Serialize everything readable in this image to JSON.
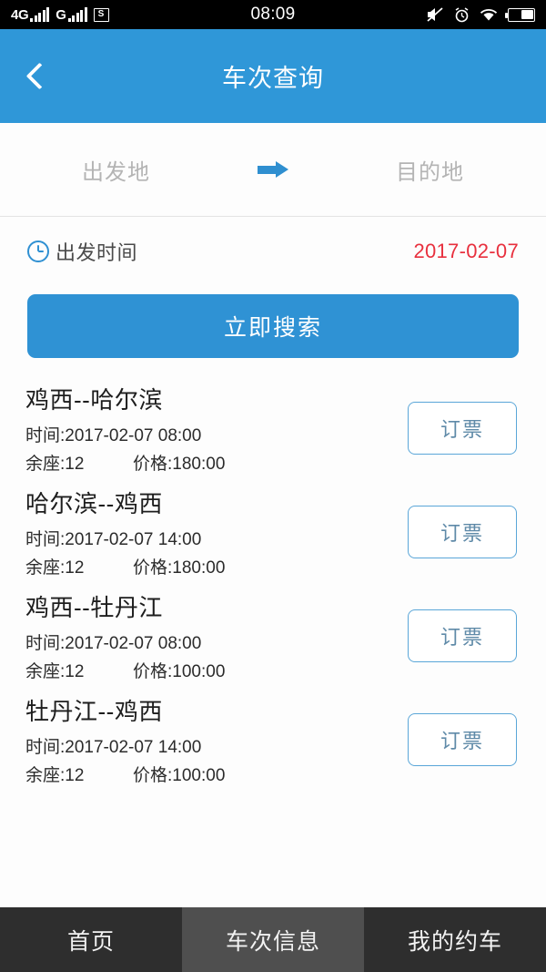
{
  "statusbar": {
    "network_label_1": "4G",
    "network_label_2": "G",
    "sdcard_glyph": "S",
    "time": "08:09",
    "icons": [
      "mute-icon",
      "alarm-icon",
      "wifi-icon",
      "battery-icon"
    ]
  },
  "header": {
    "title": "车次查询",
    "back_icon": "chevron-left-icon",
    "accent_color": "#2f97d8"
  },
  "route": {
    "origin_placeholder": "出发地",
    "destination_placeholder": "目的地",
    "arrow_icon": "arrow-right-icon"
  },
  "departure": {
    "clock_icon": "clock-icon",
    "label": "出发时间",
    "date": "2017-02-07",
    "date_color": "#e8303e"
  },
  "search": {
    "label": "立即搜索"
  },
  "results": [
    {
      "route": "鸡西--哈尔滨",
      "time": "时间:2017-02-07 08:00",
      "seats": "余座:12",
      "price": "价格:180:00",
      "book_label": "订票"
    },
    {
      "route": "哈尔滨--鸡西",
      "time": "时间:2017-02-07 14:00",
      "seats": "余座:12",
      "price": "价格:180:00",
      "book_label": "订票"
    },
    {
      "route": "鸡西--牡丹江",
      "time": "时间:2017-02-07 08:00",
      "seats": "余座:12",
      "price": "价格:100:00",
      "book_label": "订票"
    },
    {
      "route": "牡丹江--鸡西",
      "time": "时间:2017-02-07 14:00",
      "seats": "余座:12",
      "price": "价格:100:00",
      "book_label": "订票"
    }
  ],
  "tabbar": {
    "tabs": [
      {
        "label": "首页",
        "active": false
      },
      {
        "label": "车次信息",
        "active": true
      },
      {
        "label": "我的约车",
        "active": false
      }
    ]
  }
}
